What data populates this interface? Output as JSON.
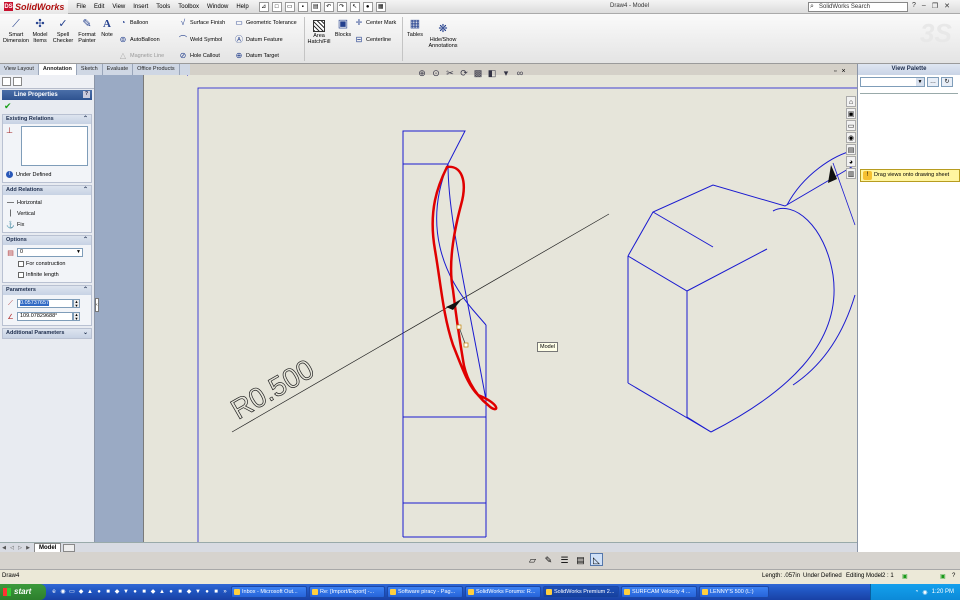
{
  "app": {
    "brand": "SolidWorks",
    "doc_title": "Draw4 - Model",
    "menus": [
      "File",
      "Edit",
      "View",
      "Insert",
      "Tools",
      "Toolbox",
      "Window",
      "Help"
    ],
    "search_placeholder": "SolidWorks Search"
  },
  "ribbon": {
    "smart_dimension": "Smart\nDimension",
    "model_items": "Model\nItems",
    "spell_checker": "Spell\nChecker",
    "format_painter": "Format\nPainter",
    "note": "Note",
    "balloon": "Balloon",
    "auto_balloon": "AutoBalloon",
    "magnetic_line": "Magnetic Line",
    "surface_finish": "Surface Finish",
    "weld_symbol": "Weld Symbol",
    "hole_callout": "Hole Callout",
    "geometric_tolerance": "Geometric Tolerance",
    "datum_feature": "Datum Feature",
    "datum_target": "Datum Target",
    "area_hatch": "Area\nHatch/Fill",
    "blocks": "Blocks",
    "center_mark": "Center Mark",
    "centerline": "Centerline",
    "tables": "Tables",
    "hide_show": "Hide/Show\nAnnotations"
  },
  "tabs": [
    "View Layout",
    "Annotation",
    "Sketch",
    "Evaluate",
    "Office Products"
  ],
  "active_tab": "Annotation",
  "property_manager": {
    "title": "Line Properties",
    "help": "?",
    "existing_relations": {
      "title": "Existing Relations",
      "status": "Under Defined"
    },
    "add_relations": {
      "title": "Add Relations",
      "items": [
        "Horizontal",
        "Vertical",
        "Fix"
      ]
    },
    "options": {
      "title": "Options",
      "layer": "0",
      "for_construction": "For construction",
      "infinite_length": "Infinite length"
    },
    "parameters": {
      "title": "Parameters",
      "length": "0.05737657",
      "angle": "109.07829688°"
    },
    "additional": {
      "title": "Additional Parameters"
    }
  },
  "drawing": {
    "dimension_label": "R0.500",
    "tooltip": "Model"
  },
  "sheet_tabs": {
    "model": "Model"
  },
  "view_palette": {
    "title": "View Palette",
    "hint": "Drag views onto drawing sheet"
  },
  "status": {
    "doc": "Draw4",
    "length": "Length: .057in",
    "defined": "Under Defined",
    "editing": "Editing Model",
    "scale": "2 : 1"
  },
  "taskbar": {
    "start": "start",
    "tasks": [
      "Inbox - Microsoft Out...",
      "Re: [Import/Export] -...",
      "Software piracy - Pag...",
      "SolidWorks Forums: R...",
      "SolidWorks Premium 2...",
      "SURFCAM Velocity 4 ...",
      "LENNY'S 500 (L:)"
    ],
    "active_index": 4,
    "clock": "1:20 PM"
  }
}
